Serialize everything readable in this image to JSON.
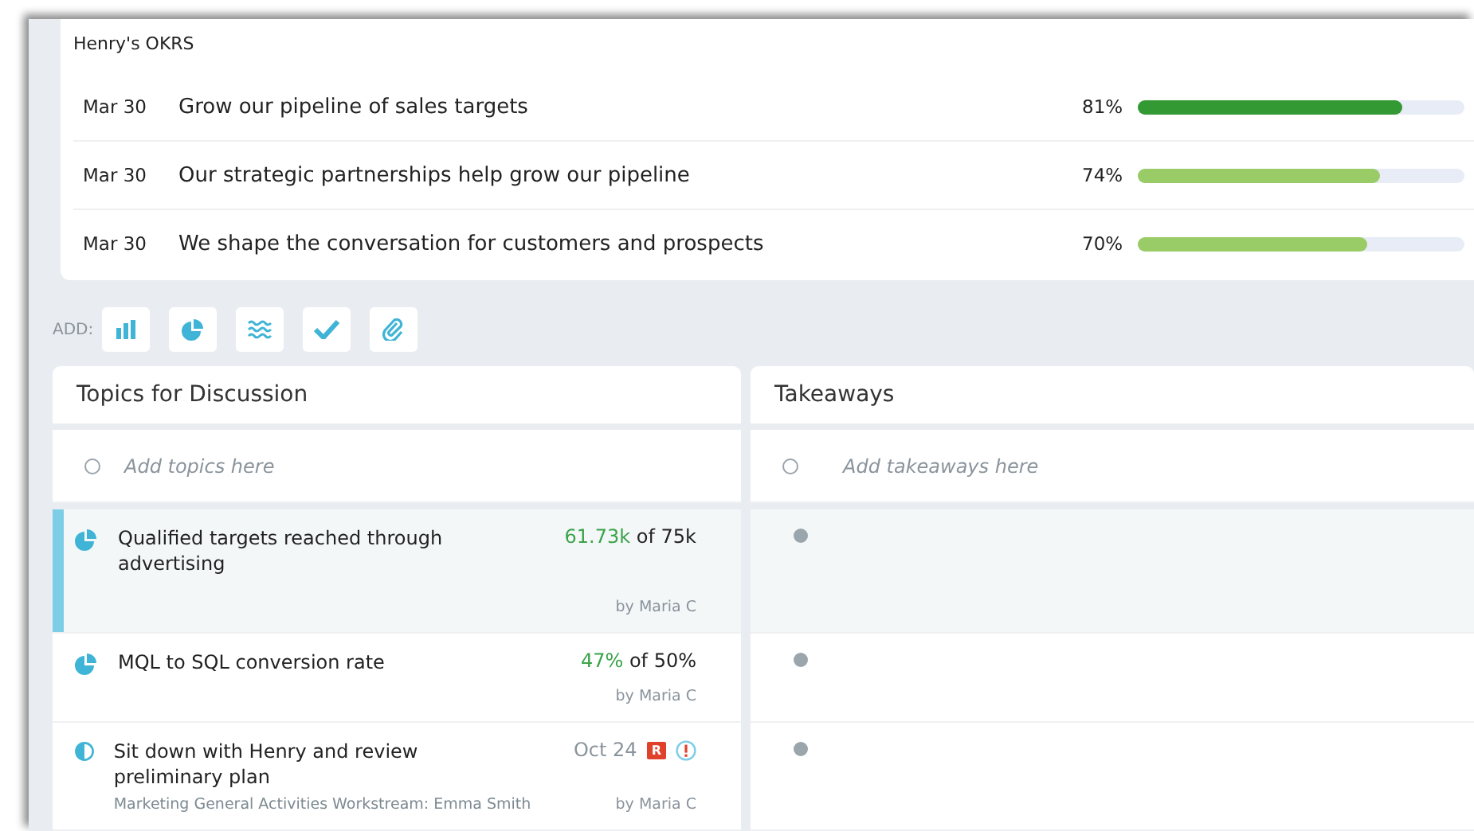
{
  "okrs": {
    "title": "Henry's OKRS",
    "items": [
      {
        "date": "Mar 30",
        "title": "Grow our pipeline of sales targets",
        "percent": "81%",
        "level": 0.81,
        "color": "#339933"
      },
      {
        "date": "Mar 30",
        "title": "Our strategic partnerships help grow our pipeline",
        "percent": "74%",
        "level": 0.74,
        "color": "#99cc66"
      },
      {
        "date": "Mar 30",
        "title": "We shape the conversation for customers and prospects",
        "percent": "70%",
        "level": 0.7,
        "color": "#99cc66"
      }
    ]
  },
  "add_toolbar": {
    "label": "ADD:",
    "buttons": [
      {
        "kind": "bars"
      },
      {
        "kind": "pie"
      },
      {
        "kind": "waves"
      },
      {
        "kind": "check"
      },
      {
        "kind": "clip"
      }
    ]
  },
  "topics": {
    "title": "Topics for Discussion",
    "placeholder": "Add topics here",
    "items": [
      {
        "kind": "metric",
        "selected": true,
        "title": "Qualified targets reached through advertising",
        "current": "61.73k",
        "target": "of 75k",
        "author": "by Maria C"
      },
      {
        "kind": "metric",
        "selected": false,
        "title": "MQL to SQL conversion rate",
        "current": "47%",
        "target": "of 50%",
        "author": "by Maria C"
      },
      {
        "kind": "task",
        "selected": false,
        "title": "Sit down with Henry and review preliminary plan",
        "date": "Oct 24",
        "badge": "R",
        "subtitle": "Marketing General Activities Workstream: Emma Smith",
        "author": "by Maria C"
      }
    ]
  },
  "takeaways": {
    "title": "Takeaways",
    "placeholder": "Add takeaways here"
  }
}
